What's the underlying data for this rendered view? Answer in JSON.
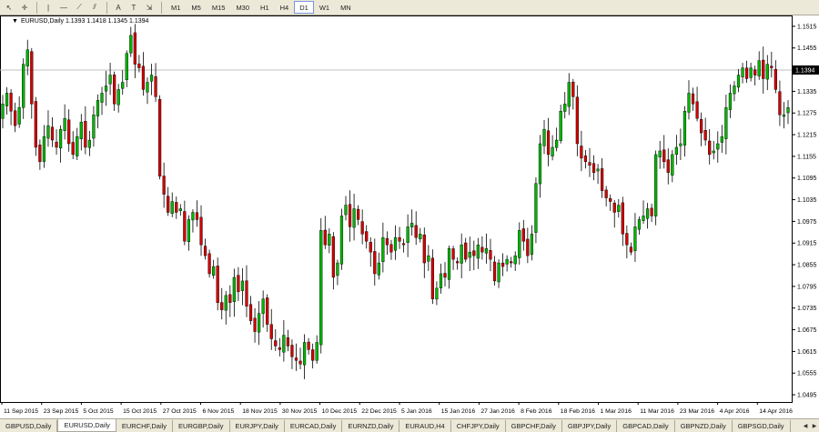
{
  "toolbar": {
    "tools": [
      {
        "name": "cursor-arrow-icon",
        "glyph": "↖"
      },
      {
        "name": "crosshair-icon",
        "glyph": "✛"
      },
      {
        "name": "vertical-line-icon",
        "glyph": "|"
      },
      {
        "name": "horizontal-line-icon",
        "glyph": "—"
      },
      {
        "name": "trendline-icon",
        "glyph": "⟋"
      },
      {
        "name": "channel-icon",
        "glyph": "⫽"
      },
      {
        "name": "text-icon",
        "glyph": "A"
      },
      {
        "name": "label-icon",
        "glyph": "T"
      },
      {
        "name": "shapes-icon",
        "glyph": "⇲"
      }
    ],
    "periods": [
      "M1",
      "M5",
      "M15",
      "M30",
      "H1",
      "H4",
      "D1",
      "W1",
      "MN"
    ],
    "active_period": "D1"
  },
  "chart_title": "EURUSD,Daily  1.1393 1.1418 1.1345 1.1394",
  "colors": {
    "bull": "#00b400",
    "bear": "#d00000",
    "wick": "#000000",
    "grid": "#ffffff",
    "price_line": "#c0c0c0"
  },
  "tabs": {
    "items": [
      "GBPUSD,Daily",
      "EURUSD,Daily",
      "EURCHF,Daily",
      "EURGBP,Daily",
      "EURJPY,Daily",
      "EURCAD,Daily",
      "EURNZD,Daily",
      "EURAUD,H4",
      "CHFJPY,Daily",
      "GBPCHF,Daily",
      "GBPJPY,Daily",
      "GBPCAD,Daily",
      "GBPNZD,Daily",
      "GBPSGD,Daily"
    ],
    "active": "EURUSD,Daily"
  },
  "chart_data": {
    "type": "candlestick",
    "symbol": "EURUSD",
    "timeframe": "Daily",
    "ylim": [
      1.0475,
      1.1545
    ],
    "y_ticks": [
      "1.1515",
      "1.1455",
      "1.1394",
      "1.1335",
      "1.1275",
      "1.1215",
      "1.1155",
      "1.1095",
      "1.1035",
      "1.0975",
      "1.0915",
      "1.0855",
      "1.0795",
      "1.0735",
      "1.0675",
      "1.0615",
      "1.0555",
      "1.0495"
    ],
    "current_price": "1.1394",
    "x_ticks": [
      "11 Sep 2015",
      "23 Sep 2015",
      "5 Oct 2015",
      "15 Oct 2015",
      "27 Oct 2015",
      "6 Nov 2015",
      "18 Nov 2015",
      "30 Nov 2015",
      "10 Dec 2015",
      "22 Dec 2015",
      "5 Jan 2016",
      "15 Jan 2016",
      "27 Jan 2016",
      "8 Feb 2016",
      "18 Feb 2016",
      "1 Mar 2016",
      "11 Mar 2016",
      "23 Mar 2016",
      "4 Apr 2016",
      "14 Apr 2016"
    ],
    "closes": [
      1.13,
      1.133,
      1.128,
      1.124,
      1.129,
      1.141,
      1.145,
      1.13,
      1.118,
      1.114,
      1.121,
      1.124,
      1.12,
      1.118,
      1.123,
      1.126,
      1.119,
      1.116,
      1.121,
      1.125,
      1.118,
      1.12,
      1.127,
      1.131,
      1.133,
      1.135,
      1.138,
      1.13,
      1.134,
      1.136,
      1.144,
      1.149,
      1.141,
      1.14,
      1.134,
      1.136,
      1.138,
      1.132,
      1.11,
      1.105,
      1.1,
      1.103,
      1.1,
      1.101,
      1.092,
      1.098,
      1.1,
      1.098,
      1.091,
      1.088,
      1.083,
      1.085,
      1.075,
      1.073,
      1.077,
      1.075,
      1.082,
      1.078,
      1.081,
      1.074,
      1.07,
      1.067,
      1.072,
      1.076,
      1.069,
      1.065,
      1.063,
      1.062,
      1.066,
      1.063,
      1.06,
      1.059,
      1.058,
      1.064,
      1.062,
      1.059,
      1.064,
      1.095,
      1.091,
      1.094,
      1.082,
      1.086,
      1.099,
      1.102,
      1.096,
      1.101,
      1.098,
      1.094,
      1.092,
      1.089,
      1.083,
      1.086,
      1.093,
      1.091,
      1.089,
      1.093,
      1.092,
      1.091,
      1.096,
      1.097,
      1.093,
      1.094,
      1.086,
      1.088,
      1.076,
      1.079,
      1.083,
      1.082,
      1.09,
      1.087,
      1.086,
      1.091,
      1.087,
      1.089,
      1.088,
      1.091,
      1.089,
      1.09,
      1.087,
      1.081,
      1.086,
      1.085,
      1.087,
      1.086,
      1.088,
      1.095,
      1.092,
      1.088,
      1.094,
      1.108,
      1.119,
      1.123,
      1.116,
      1.118,
      1.12,
      1.128,
      1.13,
      1.136,
      1.132,
      1.119,
      1.115,
      1.114,
      1.113,
      1.111,
      1.112,
      1.106,
      1.104,
      1.103,
      1.1,
      1.102,
      1.094,
      1.091,
      1.089,
      1.096,
      1.098,
      1.099,
      1.101,
      1.099,
      1.116,
      1.117,
      1.114,
      1.111,
      1.116,
      1.118,
      1.119,
      1.128,
      1.133,
      1.13,
      1.126,
      1.122,
      1.12,
      1.116,
      1.117,
      1.119,
      1.121,
      1.129,
      1.133,
      1.135,
      1.138,
      1.14,
      1.137,
      1.14,
      1.138,
      1.142,
      1.137,
      1.141,
      1.14,
      1.134,
      1.127,
      1.127,
      1.129
    ]
  }
}
